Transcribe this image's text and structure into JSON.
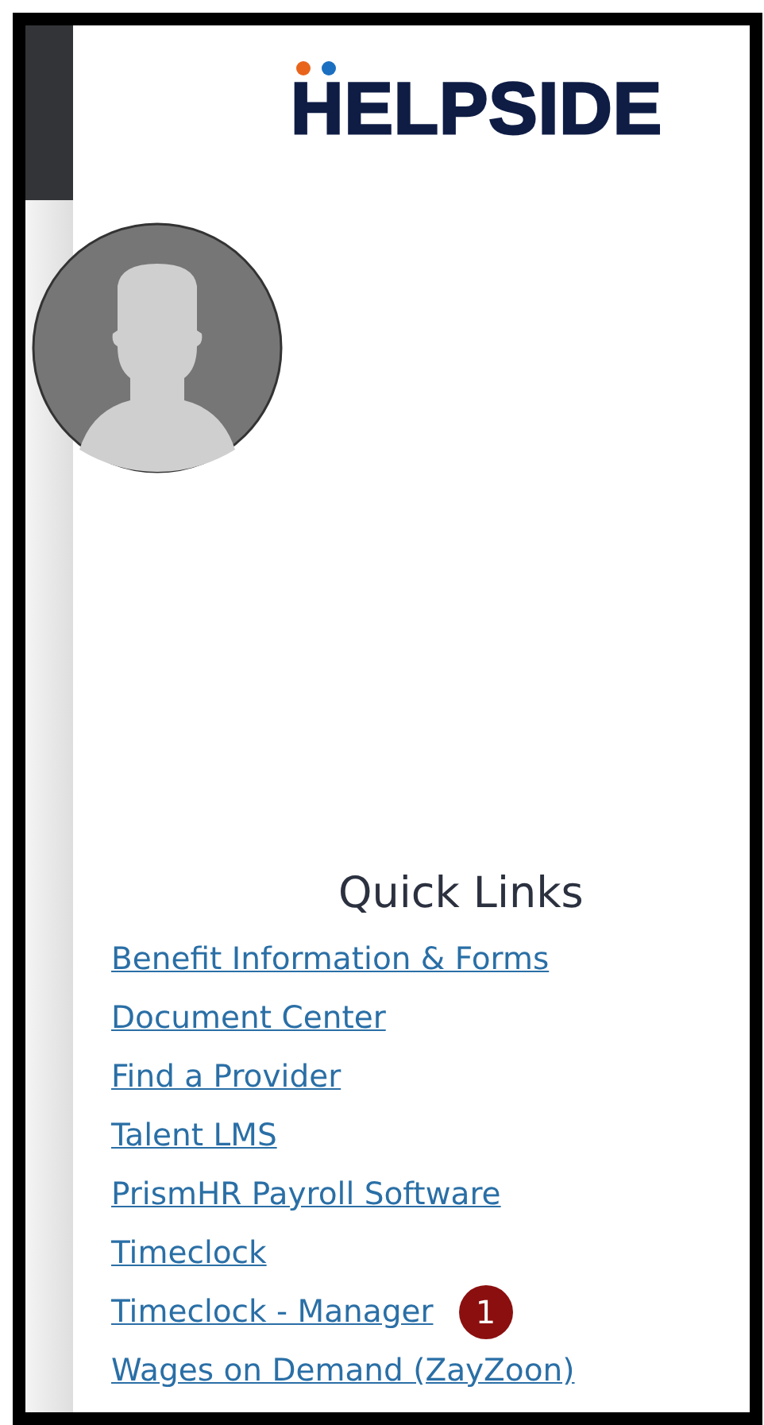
{
  "logo": {
    "text": "HELPSIDE"
  },
  "quick_links": {
    "title": "Quick Links",
    "links": [
      {
        "label": "Benefit Information & Forms"
      },
      {
        "label": "Document Center"
      },
      {
        "label": "Find a Provider"
      },
      {
        "label": "Talent LMS"
      },
      {
        "label": "PrismHR Payroll Software"
      },
      {
        "label": "Timeclock"
      },
      {
        "label": "Timeclock - Manager",
        "marker": "1"
      },
      {
        "label": "Wages on Demand (ZayZoon)"
      }
    ]
  }
}
